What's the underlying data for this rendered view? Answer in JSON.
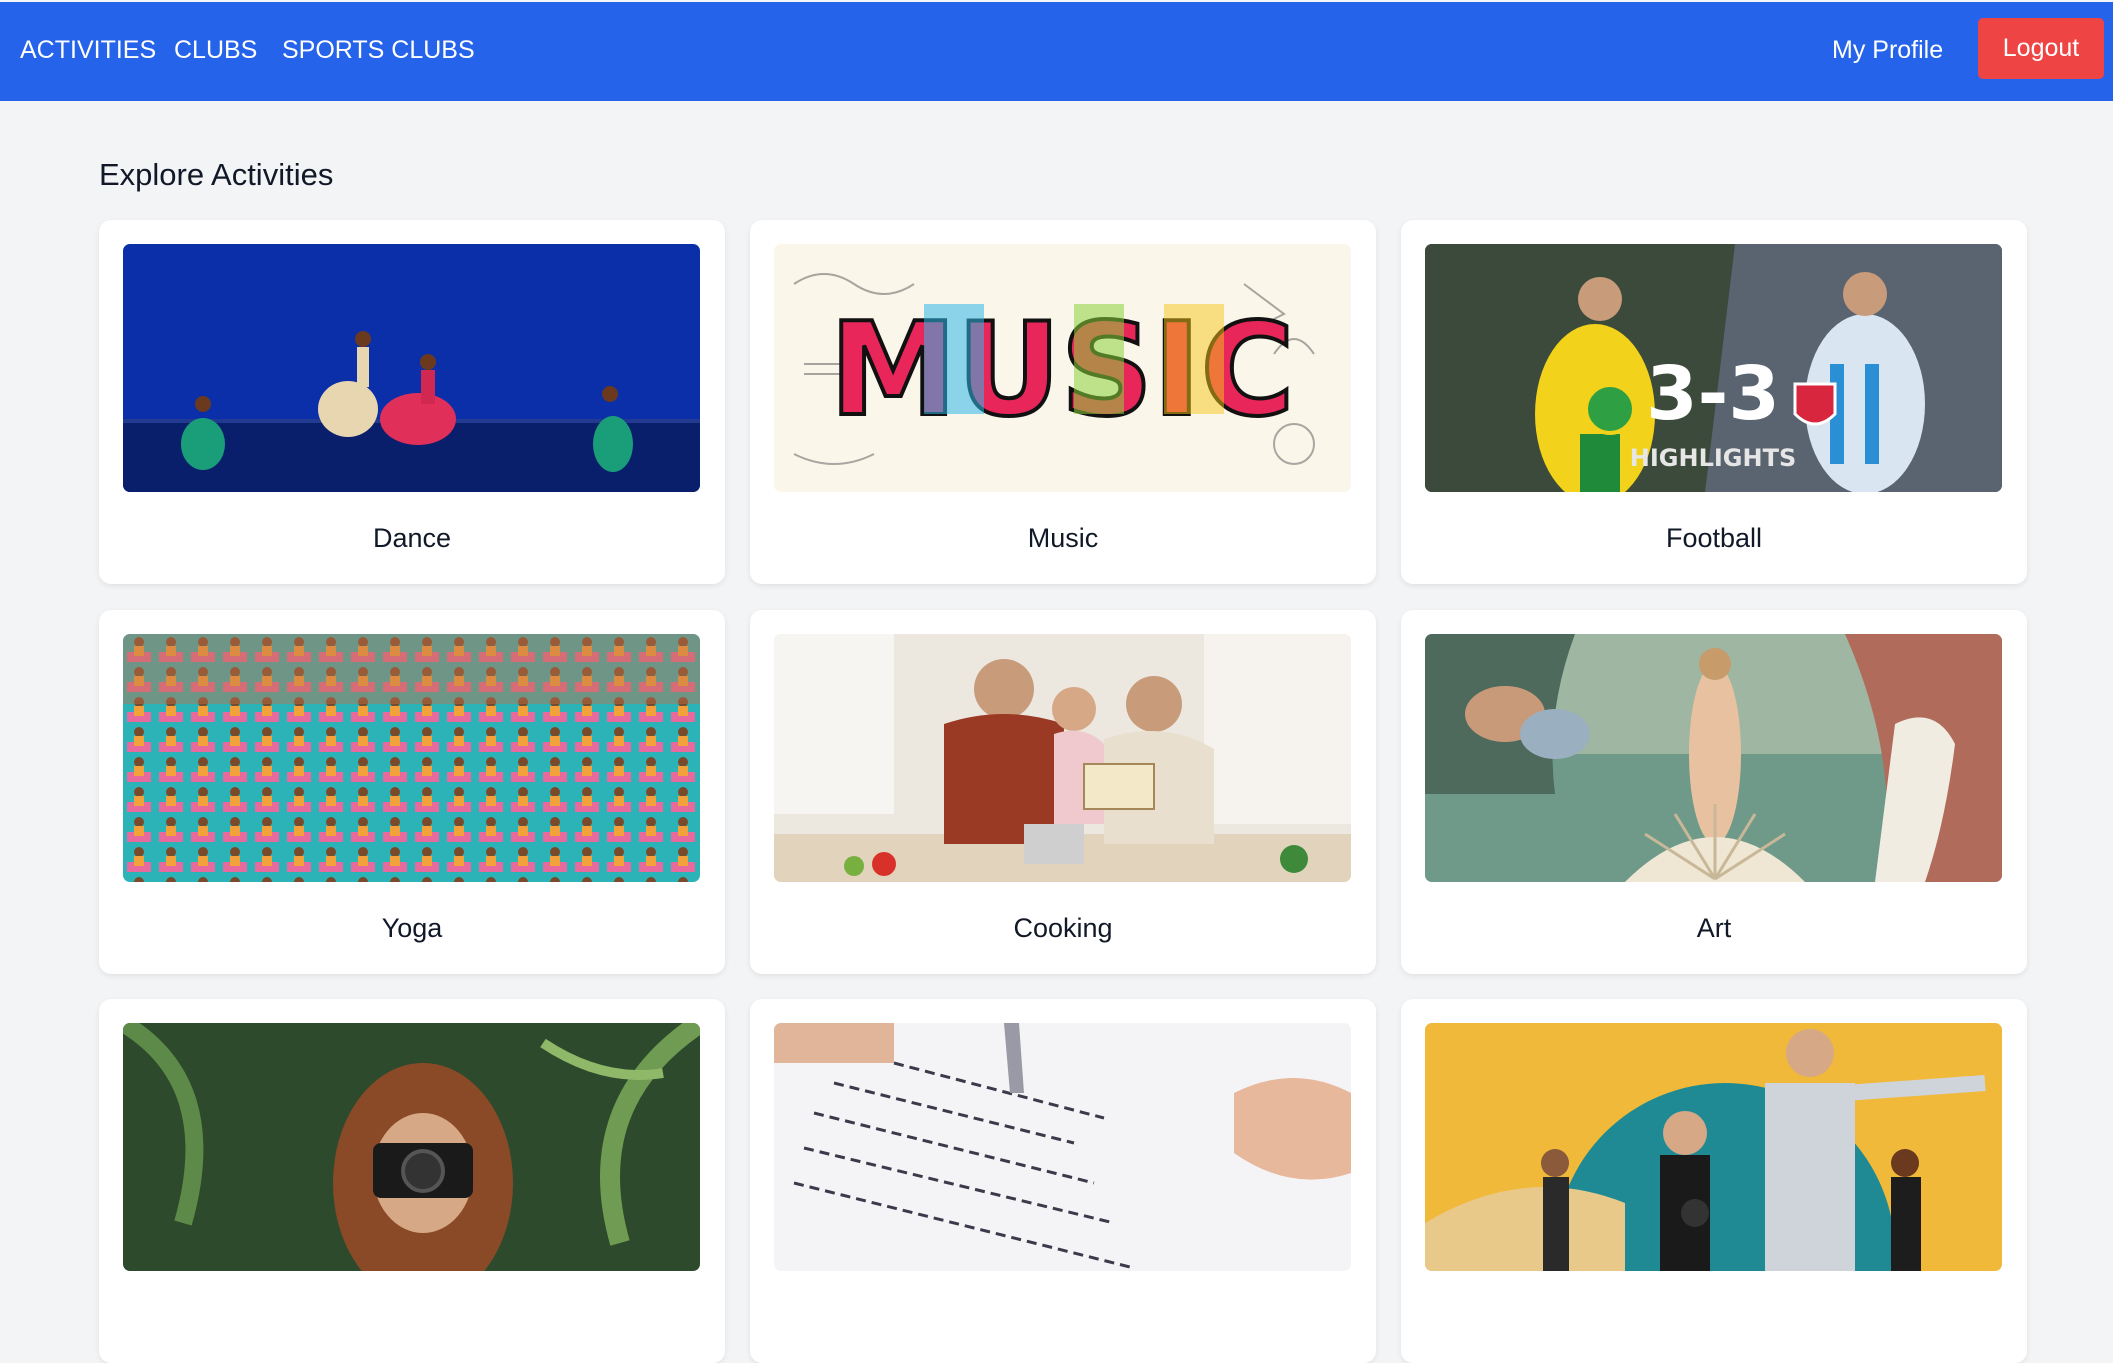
{
  "nav": {
    "links": [
      "ACTIVITIES",
      "CLUBS",
      "SPORTS CLUBS"
    ],
    "profile": "My Profile",
    "logout": "Logout"
  },
  "page": {
    "title": "Explore Activities"
  },
  "activities": [
    {
      "label": "Dance"
    },
    {
      "label": "Music",
      "image_text": "MUSIC"
    },
    {
      "label": "Football",
      "image_score": "3-3",
      "image_caption": "HIGHLIGHTS"
    },
    {
      "label": "Yoga"
    },
    {
      "label": "Cooking"
    },
    {
      "label": "Art"
    },
    {
      "label": ""
    },
    {
      "label": ""
    },
    {
      "label": ""
    }
  ],
  "colors": {
    "navbar": "#2563eb",
    "logout": "#ef4444",
    "background": "#f3f4f6",
    "card": "#ffffff"
  }
}
